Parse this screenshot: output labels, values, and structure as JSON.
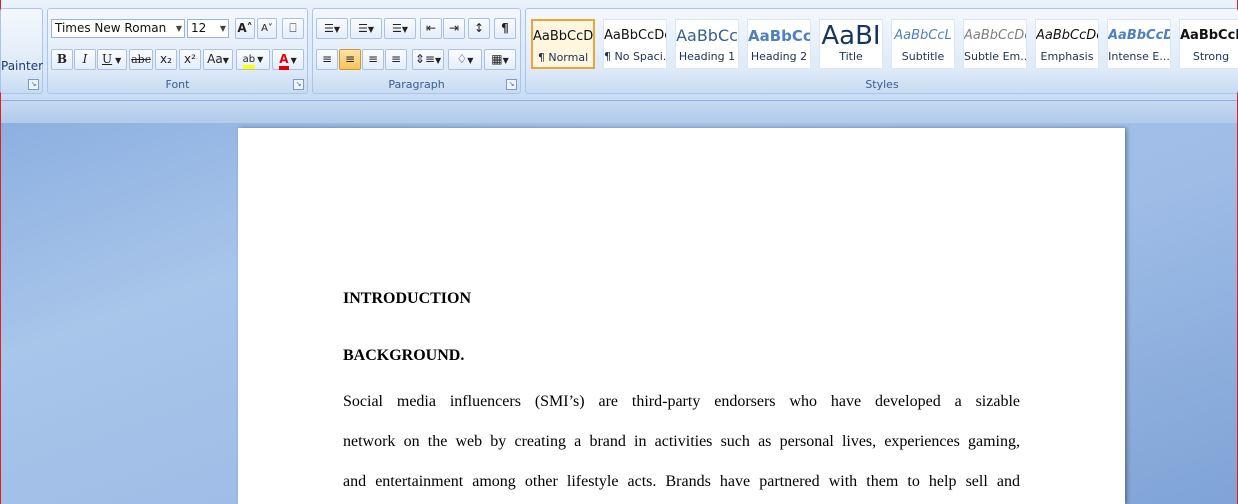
{
  "clipboard": {
    "painter_label": "Painter"
  },
  "font": {
    "group_label": "Font",
    "font_name": "Times New Roman",
    "font_size": "12",
    "grow": "A˄",
    "shrink": "A˅",
    "clear": "⎕",
    "bold": "B",
    "italic": "I",
    "underline": "U",
    "strike": "abc",
    "subscript": "x₂",
    "superscript": "x²",
    "change_case": "Aa",
    "highlight": "ab",
    "font_color": "A"
  },
  "paragraph": {
    "group_label": "Paragraph",
    "bullets": "☰",
    "numbering": "☰",
    "multilevel": "☰",
    "decrease_indent": "⇤",
    "increase_indent": "⇥",
    "sort": "↕",
    "show_marks": "¶"
  },
  "styles": {
    "group_label": "Styles",
    "items": [
      {
        "sample": "AaBbCcDc",
        "name": "¶ Normal",
        "color": "#111111"
      },
      {
        "sample": "AaBbCcDc",
        "name": "¶ No Spaci...",
        "color": "#111111"
      },
      {
        "sample": "AaBbCc",
        "name": "Heading 1",
        "color": "#365f91"
      },
      {
        "sample": "AaBbCc",
        "name": "Heading 2",
        "color": "#4f81bd"
      },
      {
        "sample": "AaBI",
        "name": "Title",
        "color": "#17365d"
      },
      {
        "sample": "AaBbCcL",
        "name": "Subtitle",
        "color": "#4f81bd"
      },
      {
        "sample": "AaBbCcDc",
        "name": "Subtle Em...",
        "color": "#808080"
      },
      {
        "sample": "AaBbCcDc",
        "name": "Emphasis",
        "color": "#111111"
      },
      {
        "sample": "AaBbCcDc",
        "name": "Intense E...",
        "color": "#4f81bd"
      },
      {
        "sample": "AaBbCcD",
        "name": "Strong",
        "color": "#111111"
      }
    ]
  },
  "document": {
    "heading1": "INTRODUCTION",
    "heading2": "BACKGROUND.",
    "lines": [
      "Social media influencers (SMI’s) are third-party endorsers who have developed a sizable",
      "network on the web by creating a brand in activities such as personal lives, experiences gaming,",
      "and entertainment among other lifestyle acts.  Brands have partnered with them to help sell and"
    ]
  },
  "colors": {
    "highlight": "#ffff00",
    "font_color": "#e00000",
    "selected_style": "#e8a53c"
  }
}
